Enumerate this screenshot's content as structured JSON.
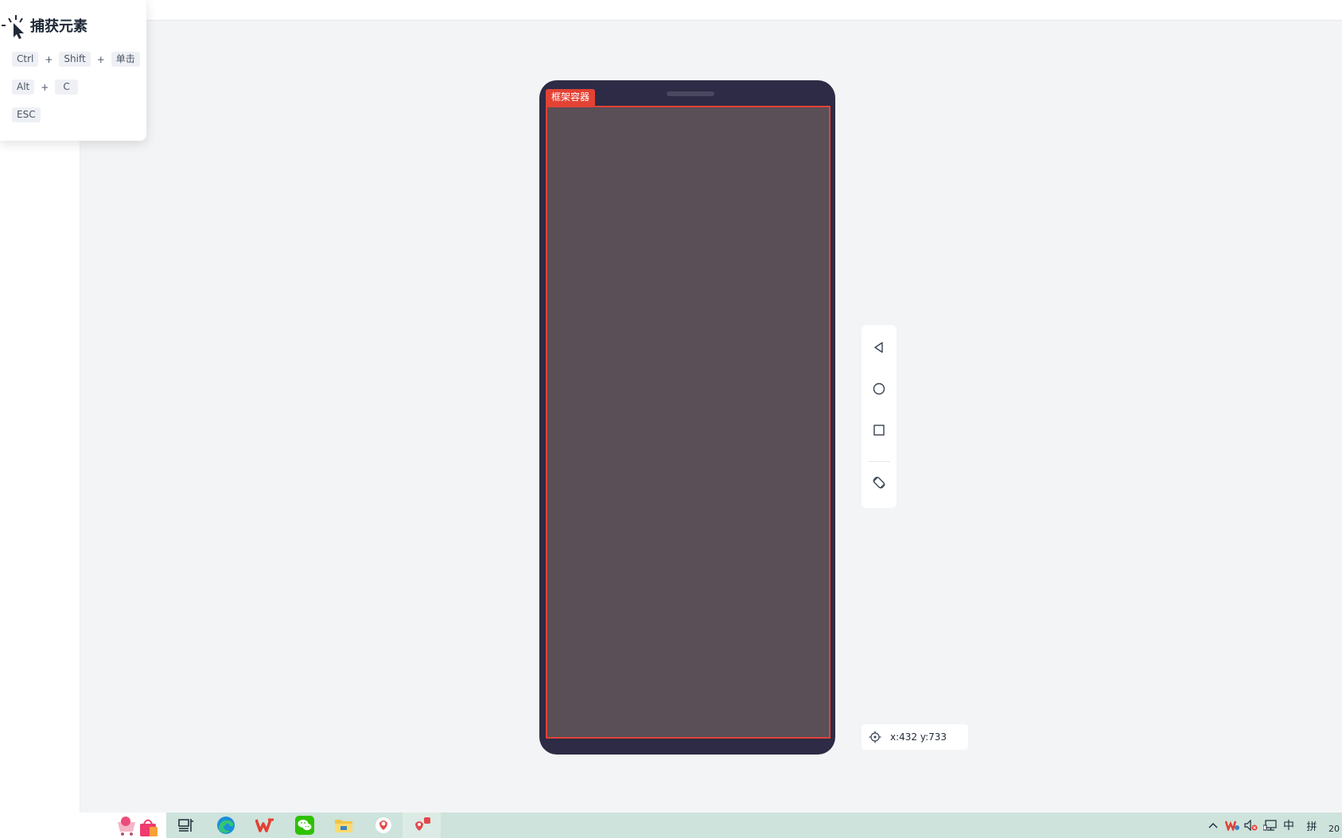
{
  "capture_popup": {
    "title": "捕获元素",
    "shortcuts": [
      {
        "keys": [
          "Ctrl",
          "Shift",
          "单击"
        ]
      },
      {
        "keys": [
          "Alt",
          "C"
        ]
      },
      {
        "keys": [
          "ESC"
        ]
      }
    ],
    "separator": "+"
  },
  "phone": {
    "frame_tag": "框架容器",
    "highlight_color": "#e34234"
  },
  "nav_panel": {
    "icons": [
      "back-triangle-icon",
      "home-circle-icon",
      "recent-square-icon",
      "rotate-icon"
    ]
  },
  "coordinates": {
    "text": "x:432 y:733"
  },
  "taskbar": {
    "apps": [
      "shopping-app-icon",
      "task-view-icon",
      "edge-browser-icon",
      "wps-icon",
      "wechat-icon",
      "file-explorer-icon",
      "app-red-icon",
      "app-red-badge-icon"
    ],
    "tray": {
      "ime_language": "中",
      "ime_mode": "拼",
      "clock_partial": "20"
    }
  }
}
